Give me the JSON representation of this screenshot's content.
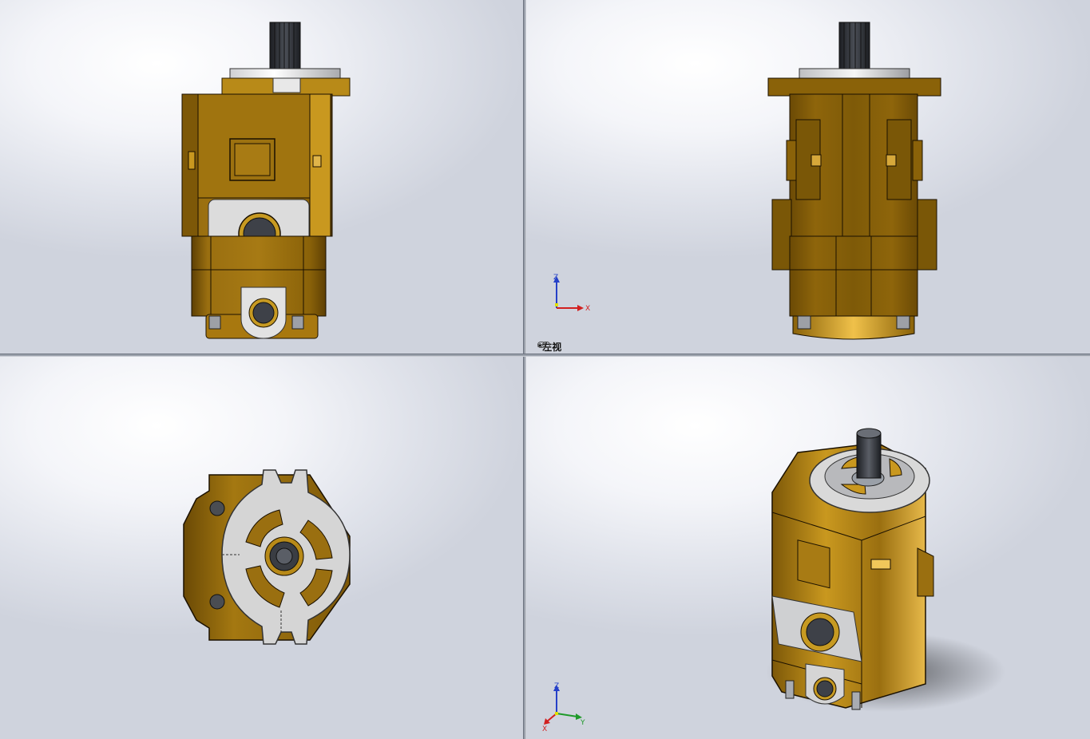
{
  "viewports": {
    "top_left": {
      "view": "front"
    },
    "top_right": {
      "view": "left",
      "label": "*左视",
      "active": true
    },
    "bottom_left": {
      "view": "top"
    },
    "bottom_right": {
      "view": "isometric"
    }
  },
  "triad_top_right": {
    "axis_up": "Z",
    "axis_right": "X"
  },
  "triad_bottom_right": {
    "axis_up": "Z",
    "axis_right": "Y",
    "axis_left": "X"
  },
  "colors": {
    "body_gold": "#9a6f10",
    "body_gold_light": "#c9981f",
    "body_gold_dark": "#6b4a05",
    "plate_gray": "#d9d9d9",
    "shaft_dark": "#2b2e34",
    "axis_x": "#d22020",
    "axis_y": "#1f9a2a",
    "axis_z": "#2540c8"
  },
  "icons": [
    "link-icon",
    "coordinate-triad-icon"
  ]
}
